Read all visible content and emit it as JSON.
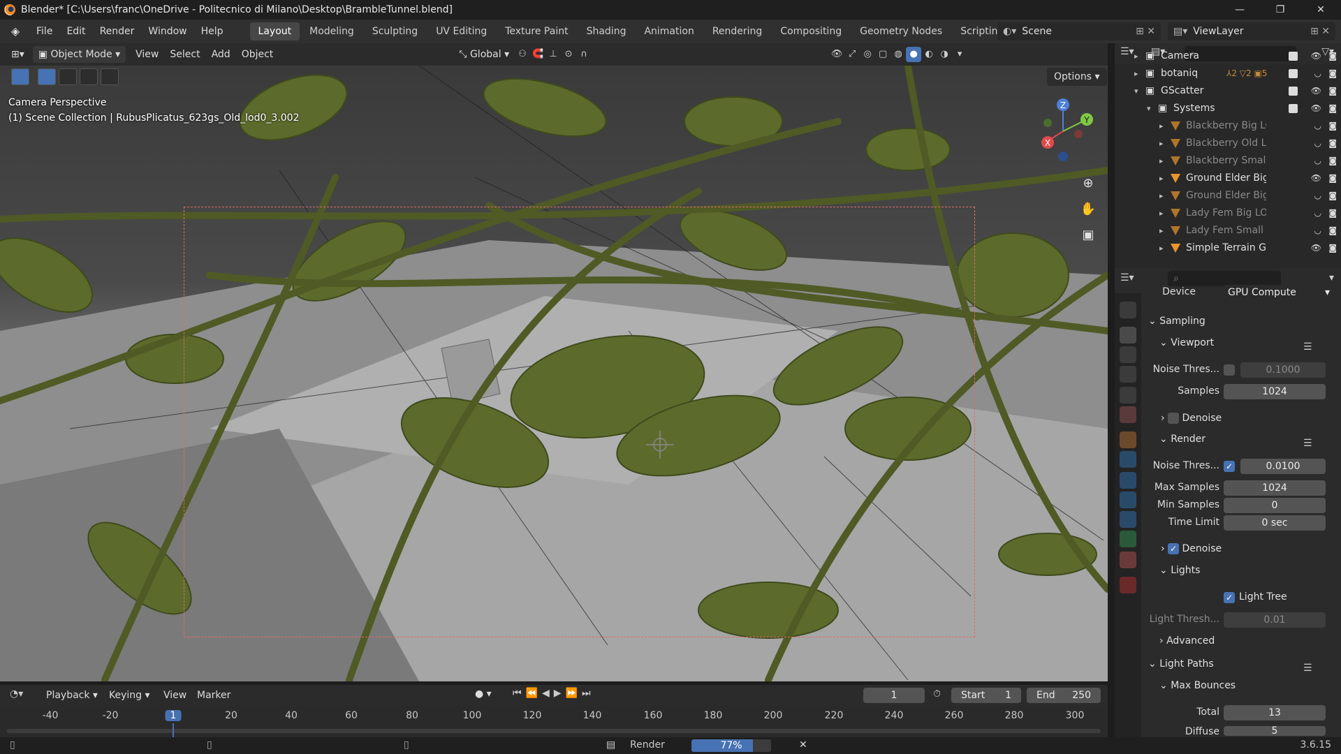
{
  "window": {
    "title": "Blender* [C:\\Users\\franc\\OneDrive - Politecnico di Milano\\Desktop\\BrambleTunnel.blend]",
    "controls": [
      "—",
      "❐",
      "✕"
    ]
  },
  "menubar": {
    "menus": [
      "File",
      "Edit",
      "Render",
      "Window",
      "Help"
    ],
    "workspaces": [
      "Layout",
      "Modeling",
      "Sculpting",
      "UV Editing",
      "Texture Paint",
      "Shading",
      "Animation",
      "Rendering",
      "Compositing",
      "Geometry Nodes",
      "Scripting"
    ],
    "active_workspace": "Layout",
    "add_tab": "+",
    "scene": "Scene",
    "view_layer": "ViewLayer"
  },
  "viewport_header": {
    "mode": "Object Mode",
    "menus": [
      "View",
      "Select",
      "Add",
      "Object"
    ],
    "transform_orientation": "Global",
    "options": "Options"
  },
  "viewport": {
    "camera_label": "Camera Perspective",
    "collection_label": "(1) Scene Collection | RubusPlicatus_623gs_Old_lod0_3.002",
    "gizmo": {
      "z": "Z",
      "y": "Y",
      "x": "X"
    }
  },
  "outliner": {
    "rows": [
      {
        "name": "Camera",
        "color": "#e0e0e0",
        "dim": false
      },
      {
        "name": "botaniq",
        "color": "#e0e0e0",
        "dim": false,
        "badge1": "2",
        "badge2": "2",
        "badge3": "5"
      },
      {
        "name": "GScatter",
        "color": "#e0e0e0",
        "dim": false
      },
      {
        "name": "Systems",
        "color": "#e0e0e0",
        "dim": false
      },
      {
        "name": "Blackberry Big LO",
        "color": "#8a8a8a",
        "dim": true
      },
      {
        "name": "Blackberry Old LO",
        "color": "#8a8a8a",
        "dim": true
      },
      {
        "name": "Blackberry Small I",
        "color": "#8a8a8a",
        "dim": true
      },
      {
        "name": "Ground Elder Big I",
        "color": "#e0e0e0",
        "dim": false
      },
      {
        "name": "Ground Elder Big I",
        "color": "#8a8a8a",
        "dim": true
      },
      {
        "name": "Lady Fem Big LOD",
        "color": "#8a8a8a",
        "dim": true
      },
      {
        "name": "Lady Fem Small L",
        "color": "#8a8a8a",
        "dim": true
      },
      {
        "name": "Simple Terrain Ge",
        "color": "#e0e0e0",
        "dim": false
      }
    ]
  },
  "properties": {
    "device_label": "Device",
    "device_value": "GPU Compute",
    "sampling": "Sampling",
    "viewport": "Viewport",
    "vp_noise_label": "Noise Thres...",
    "vp_noise_value": "0.1000",
    "vp_samples_label": "Samples",
    "vp_samples_value": "1024",
    "vp_denoise": "Denoise",
    "render": "Render",
    "r_noise_label": "Noise Thres...",
    "r_noise_value": "0.0100",
    "max_samples_label": "Max Samples",
    "max_samples_value": "1024",
    "min_samples_label": "Min Samples",
    "min_samples_value": "0",
    "time_limit_label": "Time Limit",
    "time_limit_value": "0 sec",
    "r_denoise": "Denoise",
    "lights": "Lights",
    "light_tree": "Light Tree",
    "light_thresh_label": "Light Thresh...",
    "light_thresh_value": "0.01",
    "advanced": "Advanced",
    "light_paths": "Light Paths",
    "max_bounces": "Max Bounces",
    "total_label": "Total",
    "total_value": "13",
    "diffuse_label": "Diffuse",
    "diffuse_value": "5"
  },
  "timeline": {
    "menus": [
      "Playback",
      "Keying",
      "View",
      "Marker"
    ],
    "current_frame": "1",
    "start_label": "Start",
    "start_value": "1",
    "end_label": "End",
    "end_value": "250",
    "ticks": [
      "-40",
      "-20",
      "1",
      "20",
      "40",
      "60",
      "80",
      "100",
      "120",
      "140",
      "160",
      "180",
      "200",
      "220",
      "240",
      "260",
      "280",
      "300"
    ],
    "playhead": "1"
  },
  "statusbar": {
    "render_label": "Render",
    "progress_text": "77%",
    "progress": 0.77,
    "version": "3.6.15"
  }
}
